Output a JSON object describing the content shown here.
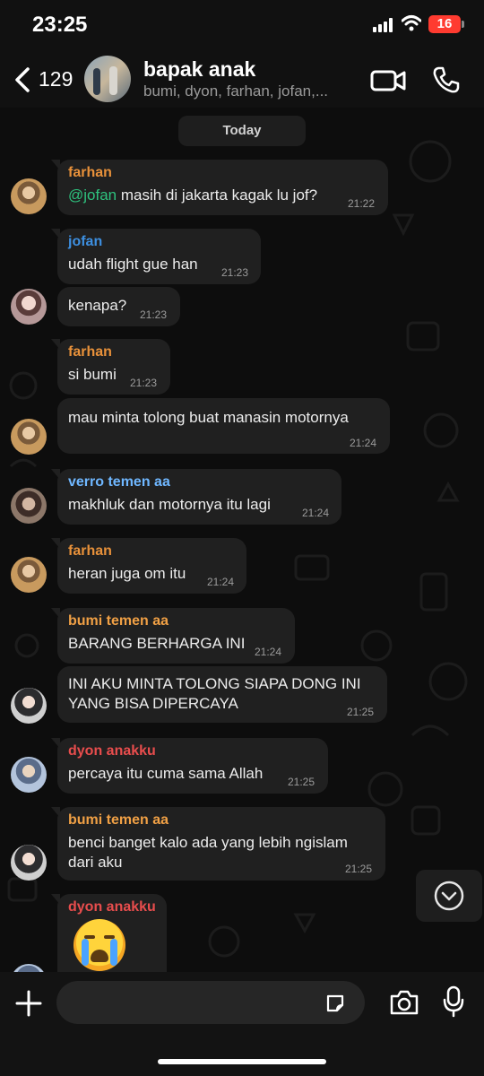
{
  "status_bar": {
    "time": "23:25",
    "battery": "16"
  },
  "header": {
    "back_count": "129",
    "title": "bapak anak",
    "subtitle": "bumi, dyon, farhan, jofan,..."
  },
  "chat": {
    "date_label": "Today",
    "messages": [
      {
        "sender": "farhan",
        "sender_color": "#e8913a",
        "mention": "@jofan",
        "text": " masih di jakarta kagak lu jof?",
        "time": "21:22"
      },
      {
        "sender": "jofan",
        "sender_color": "#3d8fe0",
        "text": "udah flight gue han",
        "time": "21:23"
      },
      {
        "text": "kenapa?",
        "time": "21:23"
      },
      {
        "sender": "farhan",
        "sender_color": "#e8913a",
        "text": "si bumi",
        "time": "21:23"
      },
      {
        "text": "mau minta tolong buat manasin motornya",
        "time": "21:24"
      },
      {
        "sender": "verro temen aa",
        "sender_color": "#6fb7ff",
        "text": "makhluk dan motornya itu lagi",
        "time": "21:24"
      },
      {
        "sender": "farhan",
        "sender_color": "#e8913a",
        "text": "heran juga om itu",
        "time": "21:24"
      },
      {
        "sender": "bumi temen aa",
        "sender_color": "#f0a045",
        "text": "BARANG BERHARGA INI",
        "time": "21:24"
      },
      {
        "line1": "INI AKU MINTA TOLONG SIAPA DONG INI",
        "line2": "YANG BISA DIPERCAYA",
        "time": "21:25"
      },
      {
        "sender": "dyon anakku",
        "sender_color": "#e84d4d",
        "text": "percaya itu cuma sama Allah",
        "time": "21:25"
      },
      {
        "sender": "bumi temen aa",
        "sender_color": "#f0a045",
        "line1": "benci banget kalo ada yang lebih ngislam",
        "line2": "dari aku",
        "time": "21:25"
      },
      {
        "sender": "dyon anakku",
        "sender_color": "#e84d4d",
        "emoji": "loudly-crying-face"
      }
    ]
  },
  "input": {
    "placeholder": ""
  },
  "icons": [
    "back-chevron",
    "video-camera",
    "phone",
    "plus",
    "sticker",
    "camera",
    "microphone",
    "chevron-down"
  ]
}
